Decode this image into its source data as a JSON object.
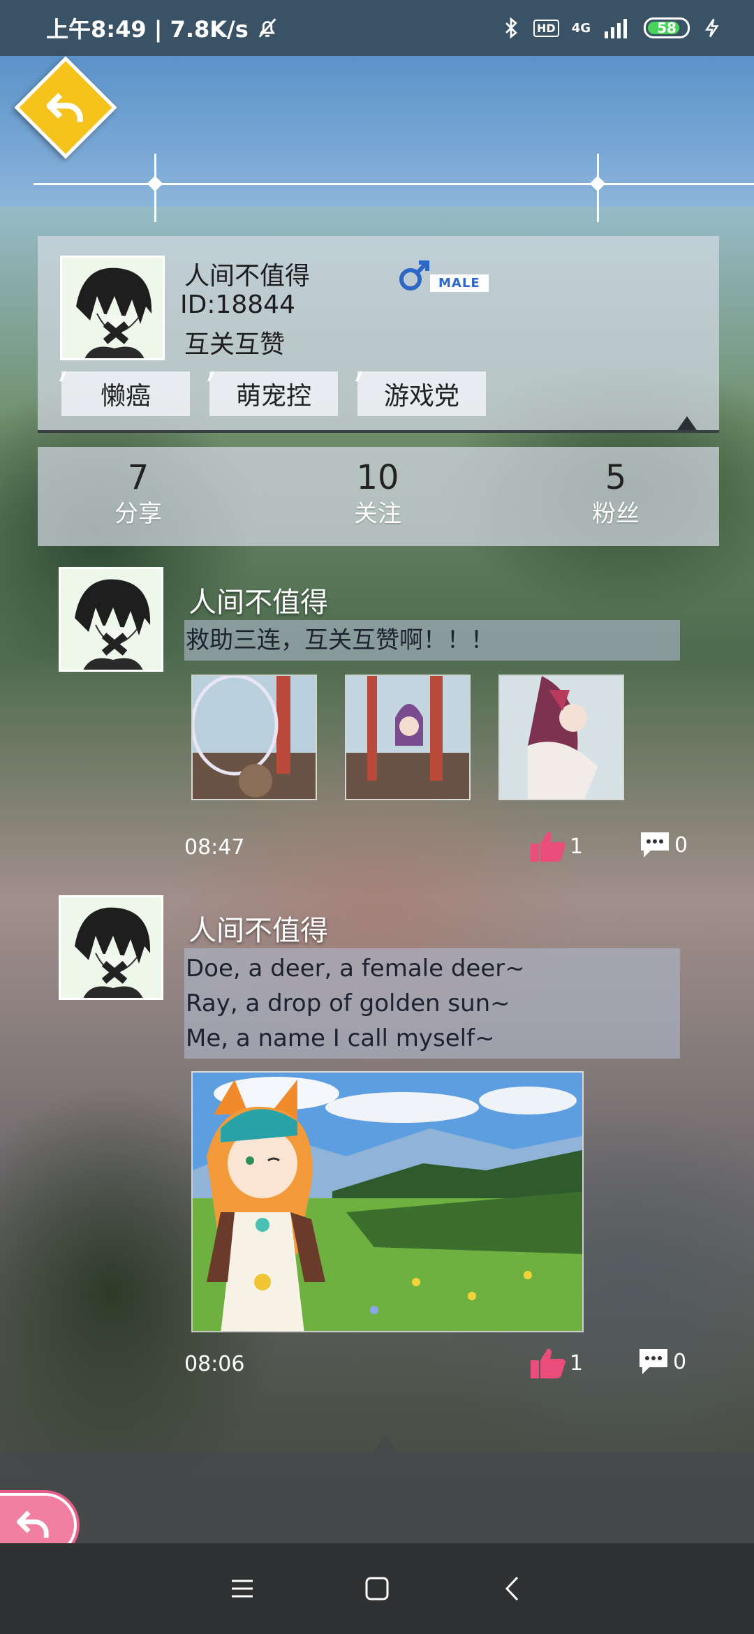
{
  "status_bar": {
    "time_speed": "上午8:49 | 7.8K/s",
    "hd": "HD",
    "network": "4G",
    "battery": "58"
  },
  "profile": {
    "name": "人间不值得",
    "id": "ID:18844",
    "motto": "互关互赞",
    "gender_label": "MALE",
    "tags": [
      "懒癌",
      "萌宠控",
      "游戏党"
    ]
  },
  "stats": [
    {
      "value": "7",
      "label": "分享"
    },
    {
      "value": "10",
      "label": "关注"
    },
    {
      "value": "5",
      "label": "粉丝"
    }
  ],
  "posts": [
    {
      "author": "人间不值得",
      "text_lines": [
        "救助三连，互关互赞啊！！！"
      ],
      "time": "08:47",
      "likes": "1",
      "comments": "0"
    },
    {
      "author": "人间不值得",
      "text_lines": [
        "Doe, a deer, a female deer~",
        "Ray, a drop of golden sun~",
        "Me, a name I call myself~"
      ],
      "time": "08:06",
      "likes": "1",
      "comments": "0"
    }
  ],
  "colors": {
    "accent_yellow": "#f6c21c",
    "accent_pink": "#f07fa2",
    "male_blue": "#2d68c6",
    "like_pink": "#ea4d7a"
  }
}
